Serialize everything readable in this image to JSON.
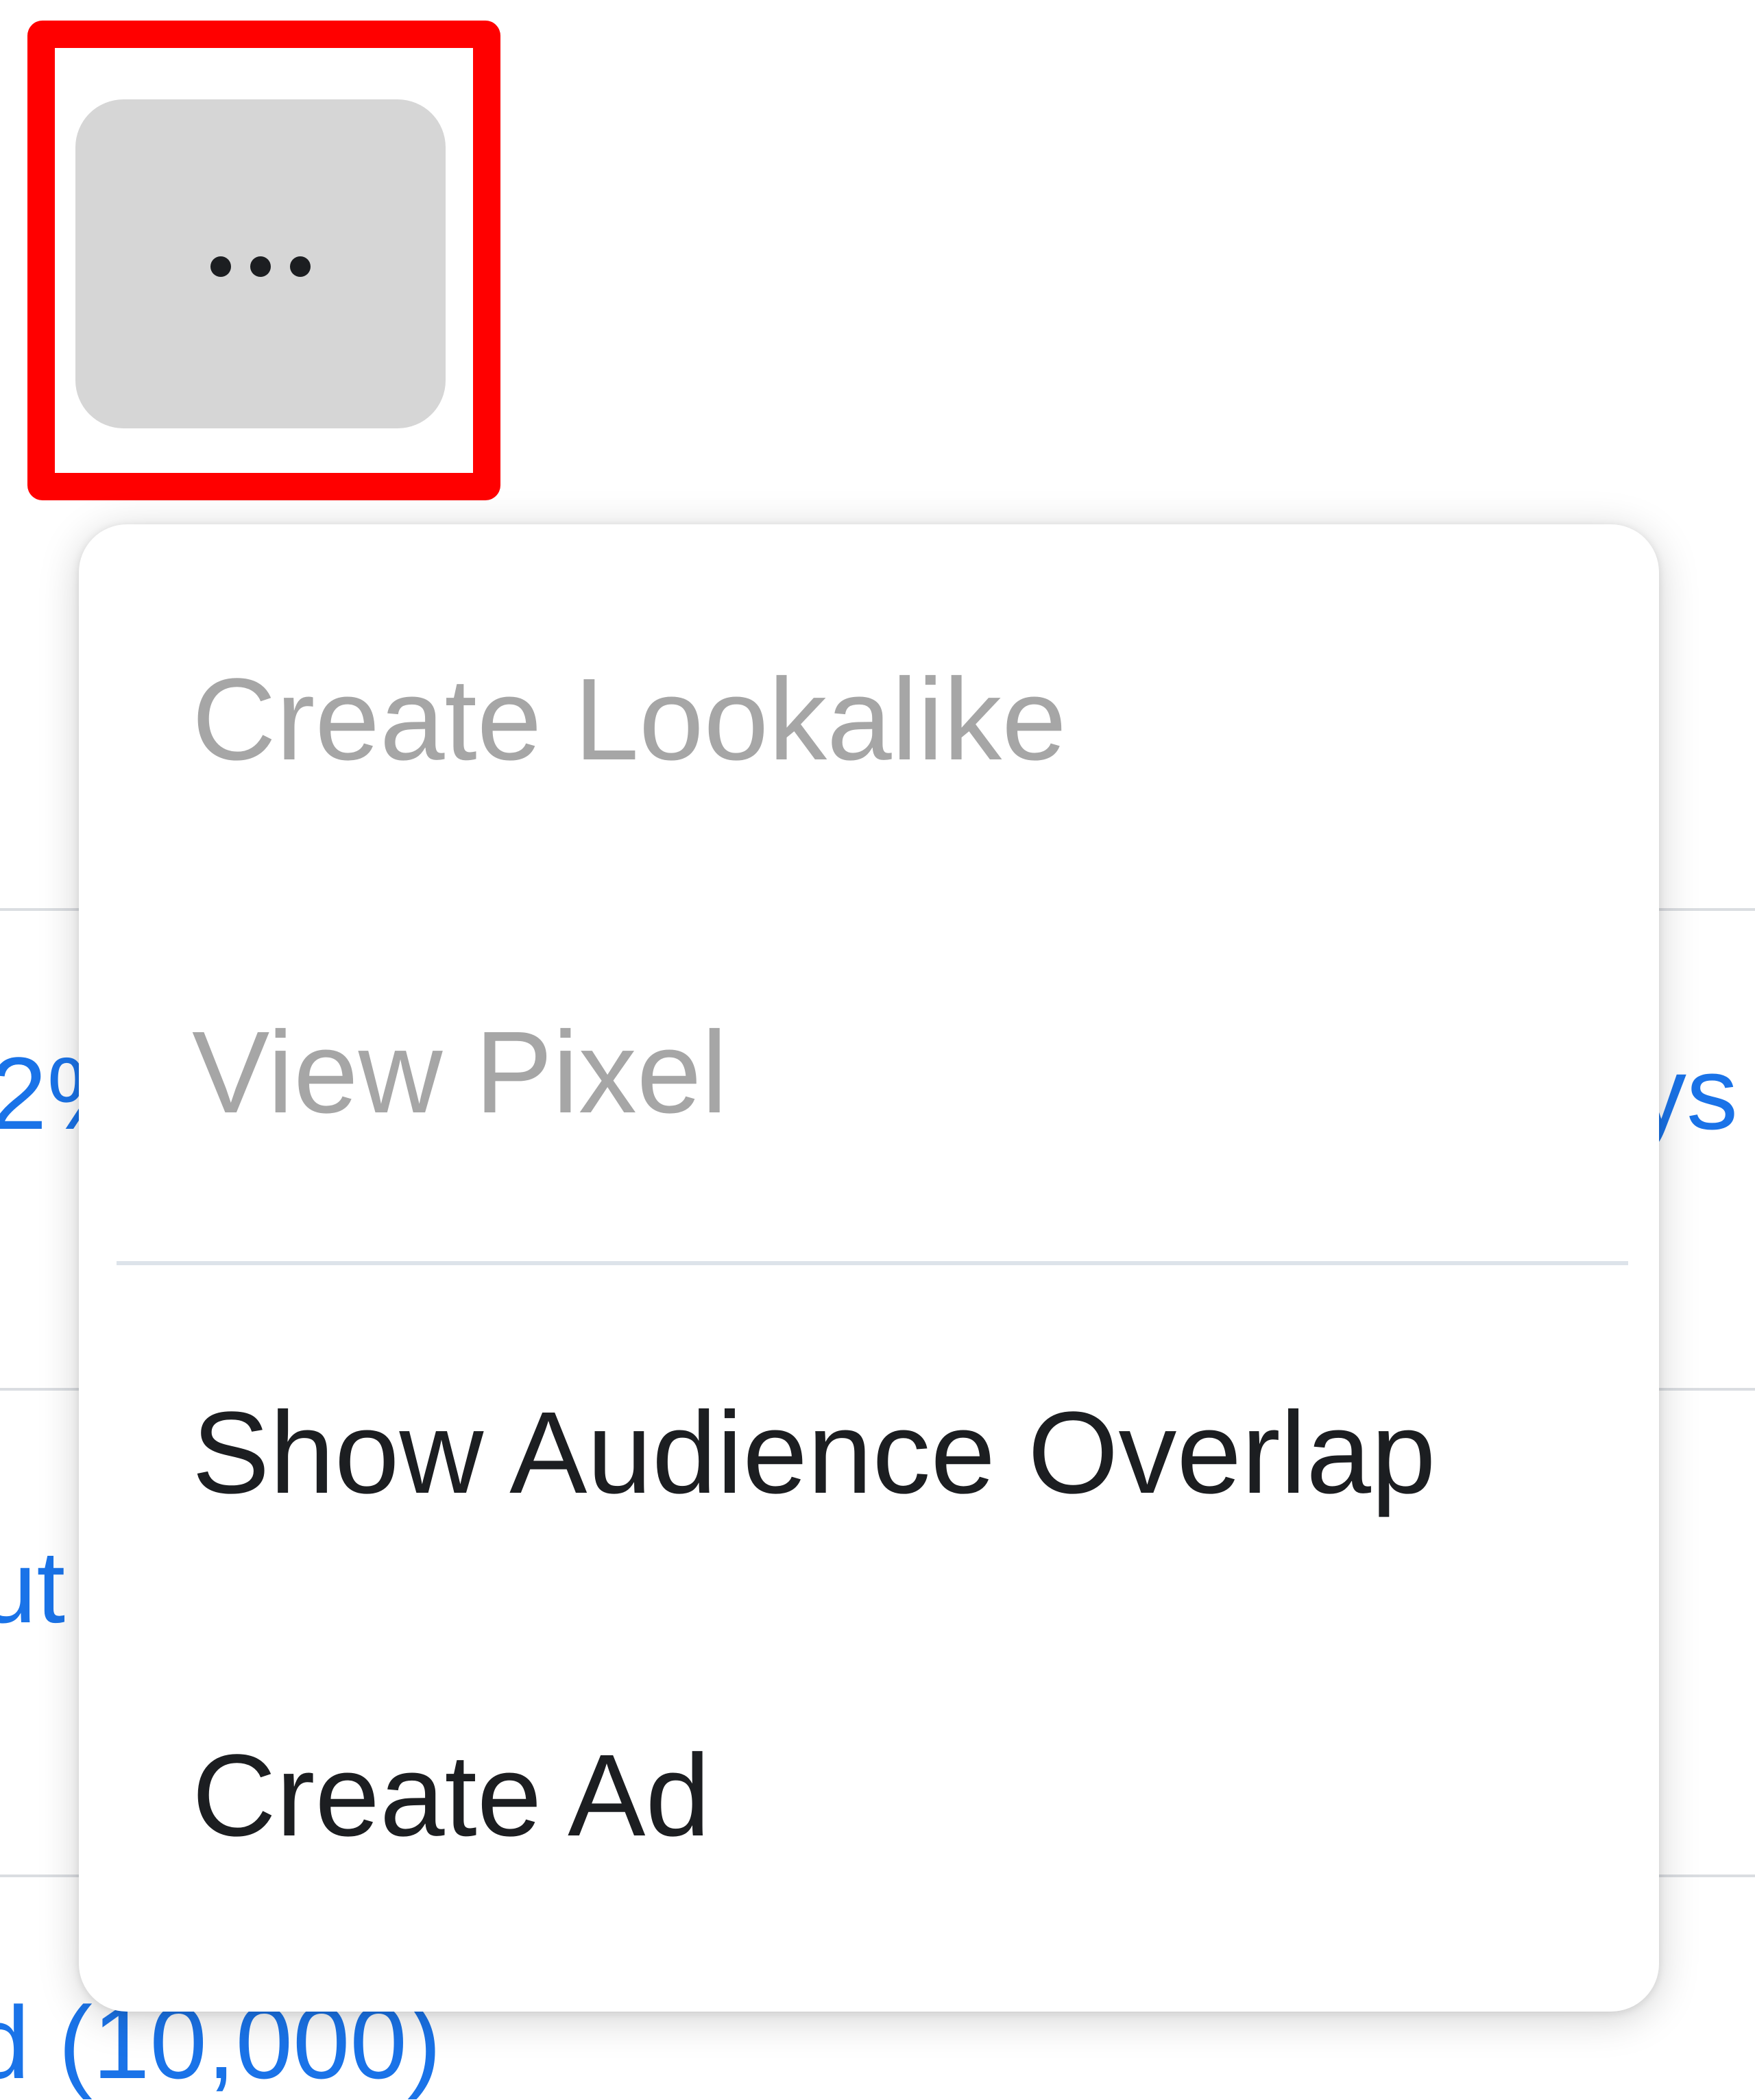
{
  "background": {
    "row_snippets": [
      "2%",
      "ys",
      "ut",
      "d (10,000)"
    ]
  },
  "more_button": {
    "icon": "more-horizontal-icon",
    "highlight_color": "#ff0000"
  },
  "menu": {
    "items": [
      {
        "label": "Create Lookalike",
        "enabled": false
      },
      {
        "label": "View Pixel",
        "enabled": false
      },
      {
        "label": "Show Audience Overlap",
        "enabled": true
      },
      {
        "label": "Create Ad",
        "enabled": true
      }
    ]
  },
  "colors": {
    "disabled_text": "#a6a6a6",
    "enabled_text": "#1c1e21",
    "link_text": "#1a73e8",
    "button_bg": "#d6d6d6"
  }
}
